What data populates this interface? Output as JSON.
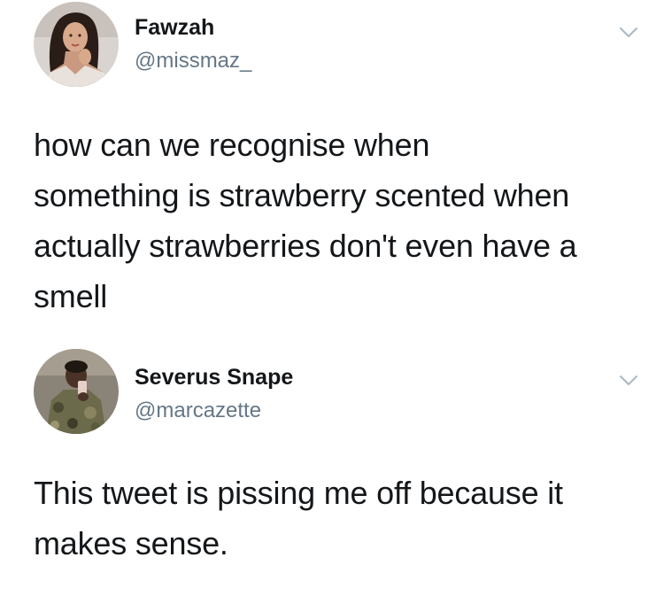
{
  "tweets": [
    {
      "author": {
        "display_name": "Fawzah",
        "handle": "@missmaz_",
        "avatar_icon": "profile-photo-woman"
      },
      "text": "how can we recognise when\nsomething is strawberry scented when\nactually strawberries don't even have a\nsmell",
      "menu_icon": "chevron-down-icon"
    },
    {
      "author": {
        "display_name": "Severus Snape",
        "handle": "@marcazette",
        "avatar_icon": "profile-photo-man"
      },
      "text": "This tweet is pissing me off because it\nmakes sense.",
      "menu_icon": "chevron-down-icon"
    }
  ],
  "colors": {
    "background": "#ffffff",
    "text_primary": "#14171a",
    "text_secondary": "#657786",
    "chevron": "#aab8c2"
  }
}
